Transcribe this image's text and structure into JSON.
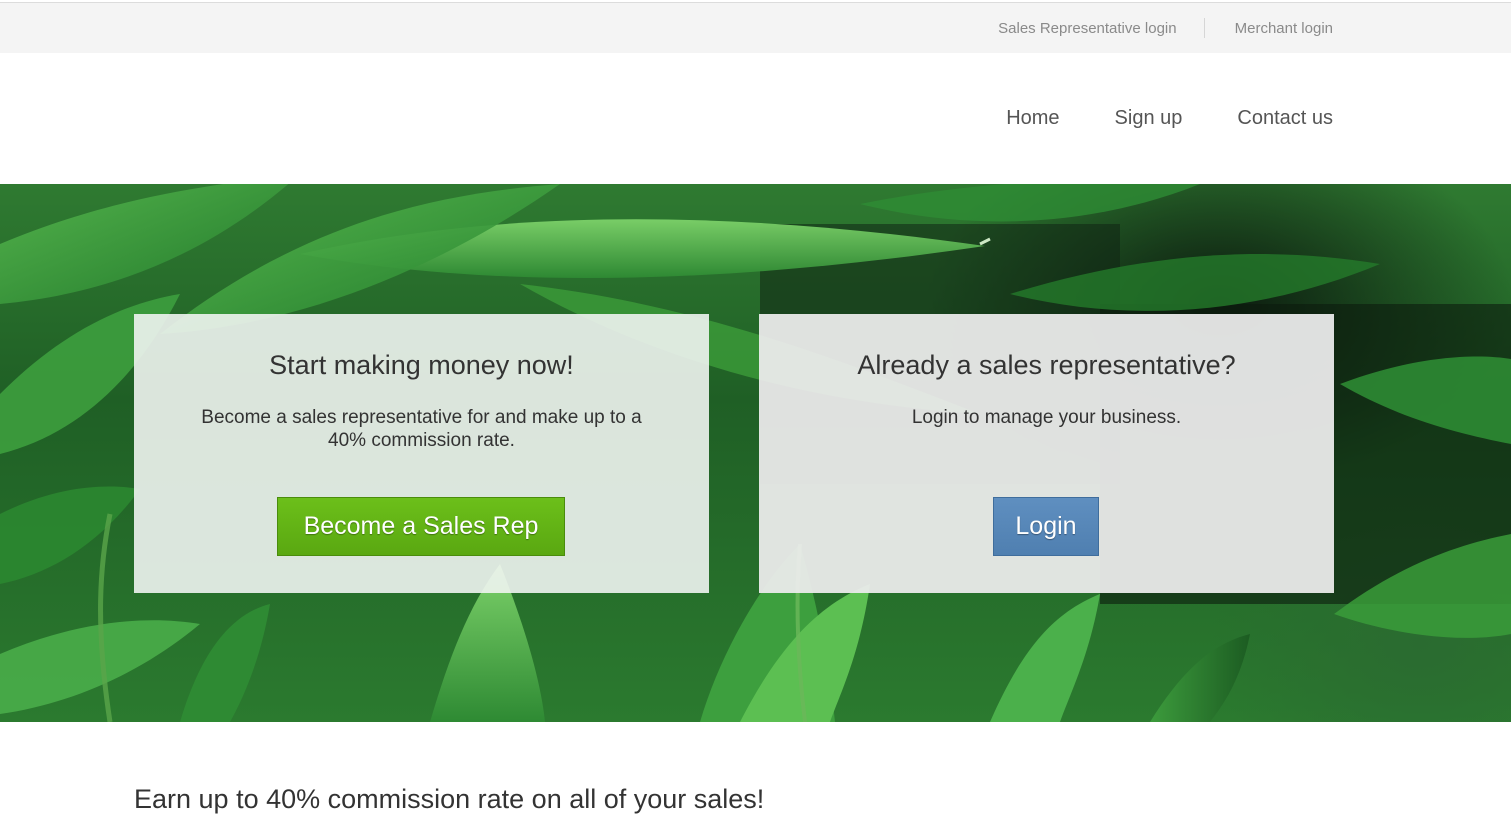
{
  "utility_bar": {
    "sales_rep_login": "Sales Representative login",
    "merchant_login": "Merchant login"
  },
  "nav": {
    "home": "Home",
    "sign_up": "Sign up",
    "contact_us": "Contact us"
  },
  "hero": {
    "left_card": {
      "title": "Start making money now!",
      "text": "Become a sales representative for and make up to a 40% commission rate.",
      "button_label": "Become a Sales Rep"
    },
    "right_card": {
      "title": "Already a sales representative?",
      "text": "Login to manage your business.",
      "button_label": "Login"
    }
  },
  "main": {
    "heading": "Earn up to 40% commission rate on all of your sales!"
  },
  "colors": {
    "primary_button": "#5aa811",
    "login_button": "#4f7fb0",
    "utility_bar_bg": "#f4f4f4",
    "text": "#333333"
  }
}
